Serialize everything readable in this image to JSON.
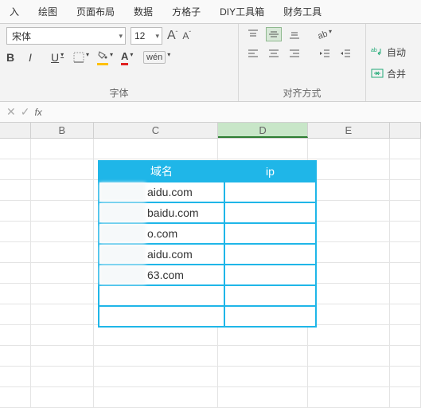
{
  "menu": {
    "items": [
      "入",
      "绘图",
      "页面布局",
      "数据",
      "方格子",
      "DIY工具箱",
      "财务工具"
    ]
  },
  "font": {
    "name": "宋体",
    "size": "12",
    "bold": "B",
    "italic": "I",
    "underline": "U",
    "wen": "wén",
    "group_label": "字体"
  },
  "align": {
    "group_label": "对齐方式"
  },
  "right": {
    "wrap": "自动",
    "merge": "合并"
  },
  "columns": {
    "B": "B",
    "C": "C",
    "D": "D",
    "E": "E"
  },
  "table": {
    "headers": {
      "domain": "域名",
      "ip": "ip"
    },
    "rows": [
      {
        "domain": "aidu.com",
        "ip": ""
      },
      {
        "domain": "baidu.com",
        "ip": ""
      },
      {
        "domain": "o.com",
        "ip": ""
      },
      {
        "domain": "aidu.com",
        "ip": ""
      },
      {
        "domain": "63.com",
        "ip": ""
      },
      {
        "domain": "",
        "ip": ""
      },
      {
        "domain": "",
        "ip": ""
      }
    ]
  }
}
